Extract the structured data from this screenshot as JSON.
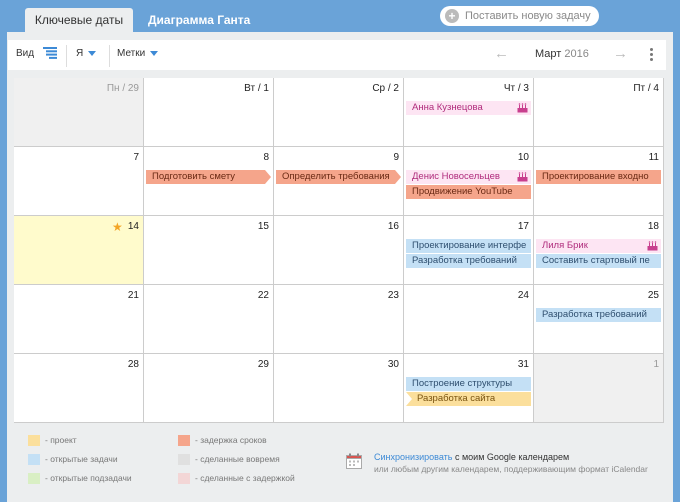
{
  "tabs": {
    "active": "Ключевые даты",
    "gantt": "Диаграмма Ганта"
  },
  "add_task": {
    "plus": "+",
    "label": "Поставить новую задачу"
  },
  "toolbar": {
    "view": "Вид",
    "me": "Я",
    "tags": "Метки",
    "prev": "←",
    "next": "→",
    "month": "Март",
    "year": "2016"
  },
  "calendar": {
    "weeks": [
      [
        {
          "label": "Пн / 29",
          "other": true
        },
        {
          "label": "Вт / 1"
        },
        {
          "label": "Ср / 2"
        },
        {
          "label": "Чт / 3"
        },
        {
          "label": "Пт / 4"
        }
      ],
      [
        {
          "label": "7"
        },
        {
          "label": "8"
        },
        {
          "label": "9"
        },
        {
          "label": "10"
        },
        {
          "label": "11"
        }
      ],
      [
        {
          "label": "14",
          "today": true
        },
        {
          "label": "15"
        },
        {
          "label": "16"
        },
        {
          "label": "17"
        },
        {
          "label": "18"
        }
      ],
      [
        {
          "label": "21"
        },
        {
          "label": "22"
        },
        {
          "label": "23"
        },
        {
          "label": "24"
        },
        {
          "label": "25"
        }
      ],
      [
        {
          "label": "28"
        },
        {
          "label": "29"
        },
        {
          "label": "30"
        },
        {
          "label": "31"
        },
        {
          "label": "1",
          "other": true
        }
      ]
    ],
    "events": [
      {
        "week": 0,
        "day": 3,
        "row": 0,
        "text": "Анна Кузнецова",
        "kind": "pink",
        "birthday": true
      },
      {
        "week": 1,
        "day": 1,
        "row": 0,
        "text": "Подготовить смету",
        "kind": "red",
        "shape": "arrow-r"
      },
      {
        "week": 1,
        "day": 2,
        "row": 0,
        "text": "Определить требования",
        "kind": "red",
        "shape": "arrow-r"
      },
      {
        "week": 1,
        "day": 3,
        "row": 0,
        "text": "Денис Новосельцев",
        "kind": "pink",
        "birthday": true
      },
      {
        "week": 1,
        "day": 3,
        "row": 1,
        "text": "Продвижение YouTube",
        "kind": "red"
      },
      {
        "week": 1,
        "day": 4,
        "row": 0,
        "text": "Проектирование входно",
        "kind": "red"
      },
      {
        "week": 2,
        "day": 3,
        "row": 0,
        "text": "Проектирование интерфе",
        "kind": "blue"
      },
      {
        "week": 2,
        "day": 3,
        "row": 1,
        "text": "Разработка требований",
        "kind": "blue"
      },
      {
        "week": 2,
        "day": 4,
        "row": 0,
        "text": "Лиля Брик",
        "kind": "pink",
        "birthday": true
      },
      {
        "week": 2,
        "day": 4,
        "row": 1,
        "text": "Составить стартовый пе",
        "kind": "blue"
      },
      {
        "week": 3,
        "day": 4,
        "row": 0,
        "text": "Разработка требований",
        "kind": "blue"
      },
      {
        "week": 4,
        "day": 3,
        "row": 0,
        "text": "Построение структуры",
        "kind": "blue"
      },
      {
        "week": 4,
        "day": 3,
        "row": 1,
        "text": "Разработка сайта",
        "kind": "yellow",
        "shape": "notch-l"
      }
    ]
  },
  "legend": [
    {
      "label": "- проект",
      "color": "#fbdf9c"
    },
    {
      "label": "- открытые задачи",
      "color": "#c4e0f5"
    },
    {
      "label": "- открытые подзадачи",
      "color": "#d9efc4"
    },
    {
      "label": "- задержка сроков",
      "color": "#f5a58b"
    },
    {
      "label": "- сделанные вовремя",
      "color": "#e0e0e0"
    },
    {
      "label": "- сделанные с задержкой",
      "color": "#f3d6d6"
    }
  ],
  "sync": {
    "link": "Синхронизировать",
    "text": " с моим Google календарем",
    "subtext": "или любым другим календарем, поддерживающим формат iCalendar"
  }
}
